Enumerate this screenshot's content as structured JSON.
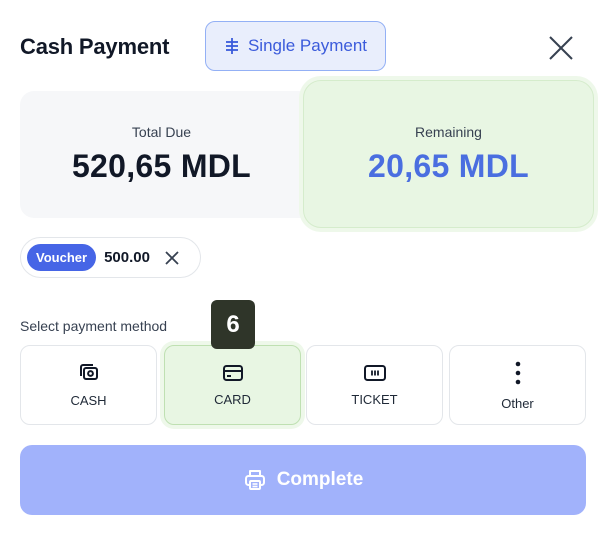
{
  "header": {
    "title": "Cash Payment",
    "mode_button_label": "Single Payment"
  },
  "summary": {
    "total_due_label": "Total Due",
    "total_due_value": "520,65 MDL",
    "remaining_label": "Remaining",
    "remaining_value": "20,65 MDL"
  },
  "voucher_chip": {
    "badge": "Voucher",
    "amount": "500.00"
  },
  "payment_methods": {
    "label": "Select payment method",
    "step_badge": "6",
    "items": [
      {
        "label": "CASH",
        "icon": "cash-icon",
        "selected": false
      },
      {
        "label": "CARD",
        "icon": "card-icon",
        "selected": true
      },
      {
        "label": "TICKET",
        "icon": "ticket-icon",
        "selected": false
      },
      {
        "label": "Other",
        "icon": "more-vertical-icon",
        "selected": false
      }
    ]
  },
  "complete_button": {
    "label": "Complete",
    "icon": "printer-icon"
  },
  "colors": {
    "accent": "#4a6ee0",
    "selected_bg": "#e8f6e3",
    "complete_bg": "#a1b2fb",
    "voucher_badge": "#4665e6"
  }
}
